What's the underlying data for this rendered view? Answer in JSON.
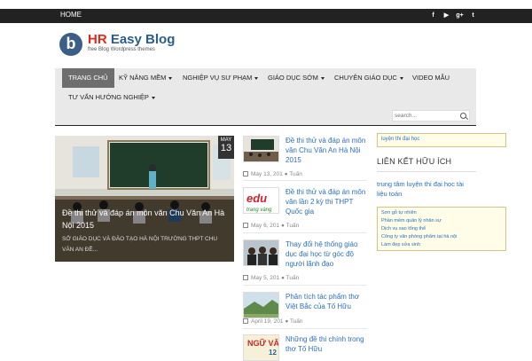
{
  "topbar": {
    "home_label": "HOME",
    "social": [
      {
        "icon": "facebook-icon",
        "glyph": "f"
      },
      {
        "icon": "youtube-icon",
        "glyph": "▶"
      },
      {
        "icon": "google-plus-icon",
        "glyph": "g+"
      },
      {
        "icon": "twitter-icon",
        "glyph": "t"
      }
    ]
  },
  "logo": {
    "mark": "b",
    "title_hr": "HR",
    "title_rest": " Easy Blog",
    "tagline": "free Blog Wordpress themes"
  },
  "nav": {
    "items": [
      {
        "label": "TRANG CHỦ",
        "active": true,
        "has_caret": false
      },
      {
        "label": "KỸ NĂNG MỀM",
        "active": false,
        "has_caret": true
      },
      {
        "label": "NGHIỆP VỤ SƯ PHẠM",
        "active": false,
        "has_caret": true
      },
      {
        "label": "GIÁO DỤC SỚM",
        "active": false,
        "has_caret": true
      },
      {
        "label": "CHUYÊN GIÁO DỤC",
        "active": false,
        "has_caret": true
      },
      {
        "label": "VIDEO MẪU",
        "active": false,
        "has_caret": false
      },
      {
        "label": "TƯ VẤN HƯỚNG NGHIỆP",
        "active": false,
        "has_caret": true
      }
    ],
    "search_placeholder": "search..."
  },
  "featured": {
    "month": "MAY",
    "day": "13",
    "title": "Đề thi thử và đáp án môn văn Chu Văn An Hà Nội 2015",
    "meta": "SỞ GIÁO DỤC VÀ ĐÀO TẠO HÀ NỘI TRƯỜNG THPT CHU VĂN AN          ĐỀ..."
  },
  "posts": [
    {
      "title": "Đề thi thử và đáp án môn văn Chu Văn An Hà Nội 2015",
      "date": "May 13, 201",
      "author": "Tuấn",
      "thumb": "classroom"
    },
    {
      "title": "Đề thi thử và đáp án môn văn lần 2 kỳ thi THPT Quốc gia",
      "date": "May 6, 201",
      "author": "Tuấn",
      "thumb": "edu-logo"
    },
    {
      "title": "Thay đổi hệ thống giáo dục đại học từ góc độ người lãnh đạo",
      "date": "May 5, 201",
      "author": "Tuấn",
      "thumb": "group"
    },
    {
      "title": "Phân tích tác phẩm thơ Việt Bắc của Tố Hữu",
      "date": "April 19, 201",
      "author": "Tuấn",
      "thumb": "landscape"
    },
    {
      "title": "Những đề thi chính trong thơ Tố Hữu",
      "date": "",
      "author": "",
      "thumb": "book-cover"
    }
  ],
  "post_thumb_texts": {
    "edu_main": "edu",
    "edu_sub": "trang vàng",
    "book_title": "NGỮ VĂN",
    "book_grade": "12"
  },
  "sidebar": {
    "top_link": "luyện thi đại học",
    "heading": "LIÊN KẾT HỮU ÍCH",
    "link_main": "trung tâm luyện thi đại học tài liệu toán",
    "links": [
      "Sơn gỗ tự nhiên",
      "Phần mềm quản lý nhân sự",
      "Dịch vụ sao tổng thể",
      "Công ty văn phòng phẩm tại hà nội",
      "Làm đẹp sửa sinh"
    ]
  },
  "colors": {
    "topbar": "#222222",
    "brand_red": "#e0291e",
    "brand_blue": "#2b5d8c",
    "link_blue": "#2a6fbf",
    "nav_bg": "#e9e9e9",
    "nav_active": "#6e6e6e"
  }
}
